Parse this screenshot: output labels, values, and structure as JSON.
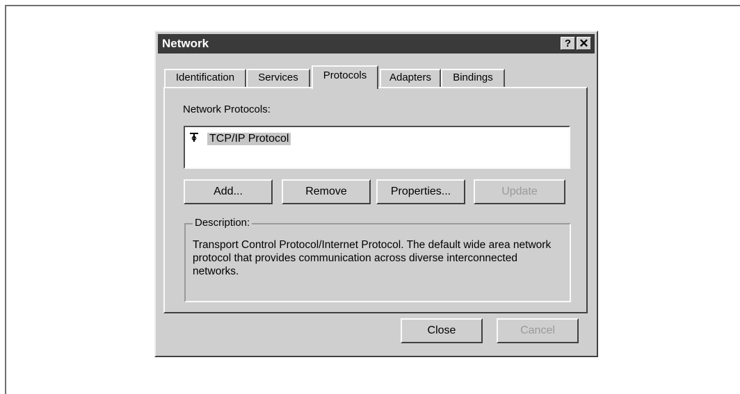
{
  "dialog": {
    "title": "Network",
    "help_glyph": "?",
    "close_glyph": "✕"
  },
  "tabs": [
    {
      "label": "Identification",
      "active": false
    },
    {
      "label": "Services",
      "active": false
    },
    {
      "label": "Protocols",
      "active": true
    },
    {
      "label": "Adapters",
      "active": false
    },
    {
      "label": "Bindings",
      "active": false
    }
  ],
  "protocols": {
    "list_label": "Network Protocols:",
    "items": [
      {
        "label": "TCP/IP Protocol",
        "icon": "network-protocol-icon",
        "selected": true
      }
    ],
    "buttons": {
      "add": "Add...",
      "remove": "Remove",
      "properties": "Properties...",
      "update": "Update"
    },
    "description_label": "Description:",
    "description_text": "Transport Control Protocol/Internet Protocol. The default wide area network protocol that provides communication across diverse interconnected networks."
  },
  "footer": {
    "close": "Close",
    "cancel": "Cancel"
  },
  "colors": {
    "face": "#cfcfcf",
    "titlebar": "#3a3a3a",
    "disabled_text": "#9a9a9a"
  }
}
